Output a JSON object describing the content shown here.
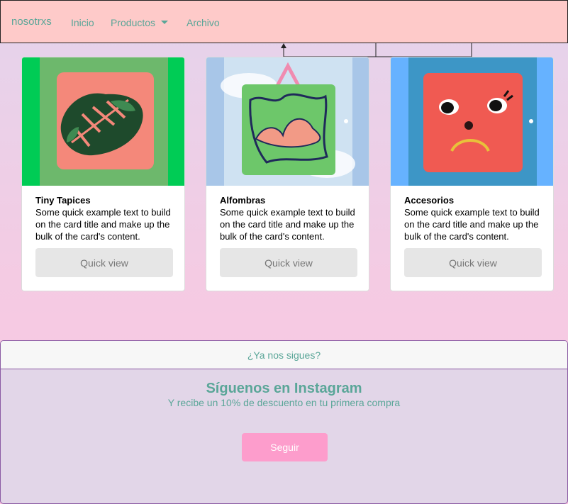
{
  "navbar": {
    "brand": "nosotrxs",
    "links": [
      "Inicio",
      "Productos",
      "Archivo"
    ]
  },
  "cards": [
    {
      "title": "Tiny Tapices",
      "text": "Some quick example text to build on the card title and make up the bulk of the card's content.",
      "button": "Quick view",
      "image_subject": "monstera-leaf-rug"
    },
    {
      "title": "Alfombras",
      "text": "Some quick example text to build on the card title and make up the bulk of the card's content.",
      "button": "Quick view",
      "image_subject": "cowboy-hat-wall-hanging"
    },
    {
      "title": "Accesorios",
      "text": "Some quick example text to build on the card title and make up the bulk of the card's content.",
      "button": "Quick view",
      "image_subject": "sad-face-rug"
    }
  ],
  "instagram": {
    "header": "¿Ya nos sigues?",
    "title": "Síguenos en Instagram",
    "subtitle": "Y recibe un 10% de descuento en tu primera compra",
    "button": "Seguir"
  },
  "colors": {
    "navbar_bg": "#fecac9",
    "link": "#5aa698",
    "follow_button": "#fd9dcc",
    "panel_bg": "#e2d6e8"
  }
}
